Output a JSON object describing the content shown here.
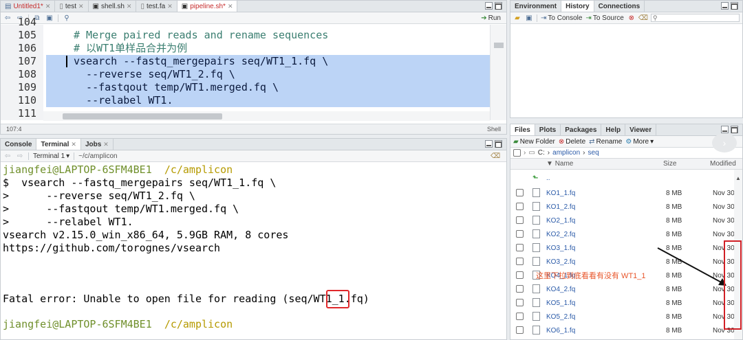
{
  "source": {
    "tabs": [
      {
        "label": "Untitled1*",
        "color": "#c62b2b"
      },
      {
        "label": "test"
      },
      {
        "label": "shell.sh"
      },
      {
        "label": "test.fa"
      },
      {
        "label": "pipeline.sh*",
        "color": "#c62b2b"
      }
    ],
    "run_label": "Run",
    "lines": [
      {
        "num": "104",
        "text": ""
      },
      {
        "num": "105",
        "text": "# Merge paired reads and rename sequences"
      },
      {
        "num": "106",
        "text": "# 以WT1单样品合并为例"
      },
      {
        "num": "107",
        "text": "vsearch --fastq_mergepairs seq/WT1_1.fq \\"
      },
      {
        "num": "108",
        "text": "  --reverse seq/WT1_2.fq \\"
      },
      {
        "num": "109",
        "text": "  --fastqout temp/WT1.merged.fq \\"
      },
      {
        "num": "110",
        "text": "  --relabel WT1."
      },
      {
        "num": "111",
        "text": ""
      }
    ],
    "status_position": "107:4",
    "status_type": "Shell"
  },
  "console": {
    "tabs": [
      "Console",
      "Terminal",
      "Jobs"
    ],
    "terminal_selector": "Terminal 1",
    "terminal_path": "~/c/amplicon",
    "user_host": "jiangfei@LAPTOP-6SFM4BE1",
    "dir": "/c/amplicon",
    "lines": [
      "$  vsearch --fastq_mergepairs seq/WT1_1.fq \\",
      ">      --reverse seq/WT1_2.fq \\",
      ">      --fastqout temp/WT1.merged.fq \\",
      ">      --relabel WT1.",
      "vsearch v2.15.0_win_x86_64, 5.9GB RAM, 8 cores",
      "https://github.com/torognes/vsearch",
      "Fatal error: Unable to open file for reading (seq/WT1_1.fq)"
    ]
  },
  "env": {
    "tabs": [
      "Environment",
      "History",
      "Connections"
    ],
    "to_console": "To Console",
    "to_source": "To Source"
  },
  "files": {
    "tabs": [
      "Files",
      "Plots",
      "Packages",
      "Help",
      "Viewer"
    ],
    "new_folder": "New Folder",
    "delete": "Delete",
    "rename": "Rename",
    "more": "More",
    "crumb_root": "C:",
    "crumb_1": "amplicon",
    "crumb_2": "seq",
    "col_name": "Name",
    "col_size": "Size",
    "col_modified": "Modified",
    "up": "..",
    "rows": [
      {
        "name": "KO1_1.fq",
        "size": "8 MB",
        "mod": "Nov 30,"
      },
      {
        "name": "KO1_2.fq",
        "size": "8 MB",
        "mod": "Nov 30,"
      },
      {
        "name": "KO2_1.fq",
        "size": "8 MB",
        "mod": "Nov 30,"
      },
      {
        "name": "KO2_2.fq",
        "size": "8 MB",
        "mod": "Nov 30,"
      },
      {
        "name": "KO3_1.fq",
        "size": "8 MB",
        "mod": "Nov 30,"
      },
      {
        "name": "KO3_2.fq",
        "size": "8 MB",
        "mod": "Nov 30,"
      },
      {
        "name": "KO4_1.fq",
        "size": "8 MB",
        "mod": "Nov 30,"
      },
      {
        "name": "KO4_2.fq",
        "size": "8 MB",
        "mod": "Nov 30,"
      },
      {
        "name": "KO5_1.fq",
        "size": "8 MB",
        "mod": "Nov 30,"
      },
      {
        "name": "KO5_2.fq",
        "size": "8 MB",
        "mod": "Nov 30,"
      },
      {
        "name": "KO6_1.fq",
        "size": "8 MB",
        "mod": "Nov 30,"
      }
    ]
  },
  "annotation": "这里下拉到底看看有没有 WT1_1",
  "colors": {
    "accent_red": "#e0272a",
    "link_blue": "#2a5aa8",
    "selection": "#bcd4f6"
  }
}
